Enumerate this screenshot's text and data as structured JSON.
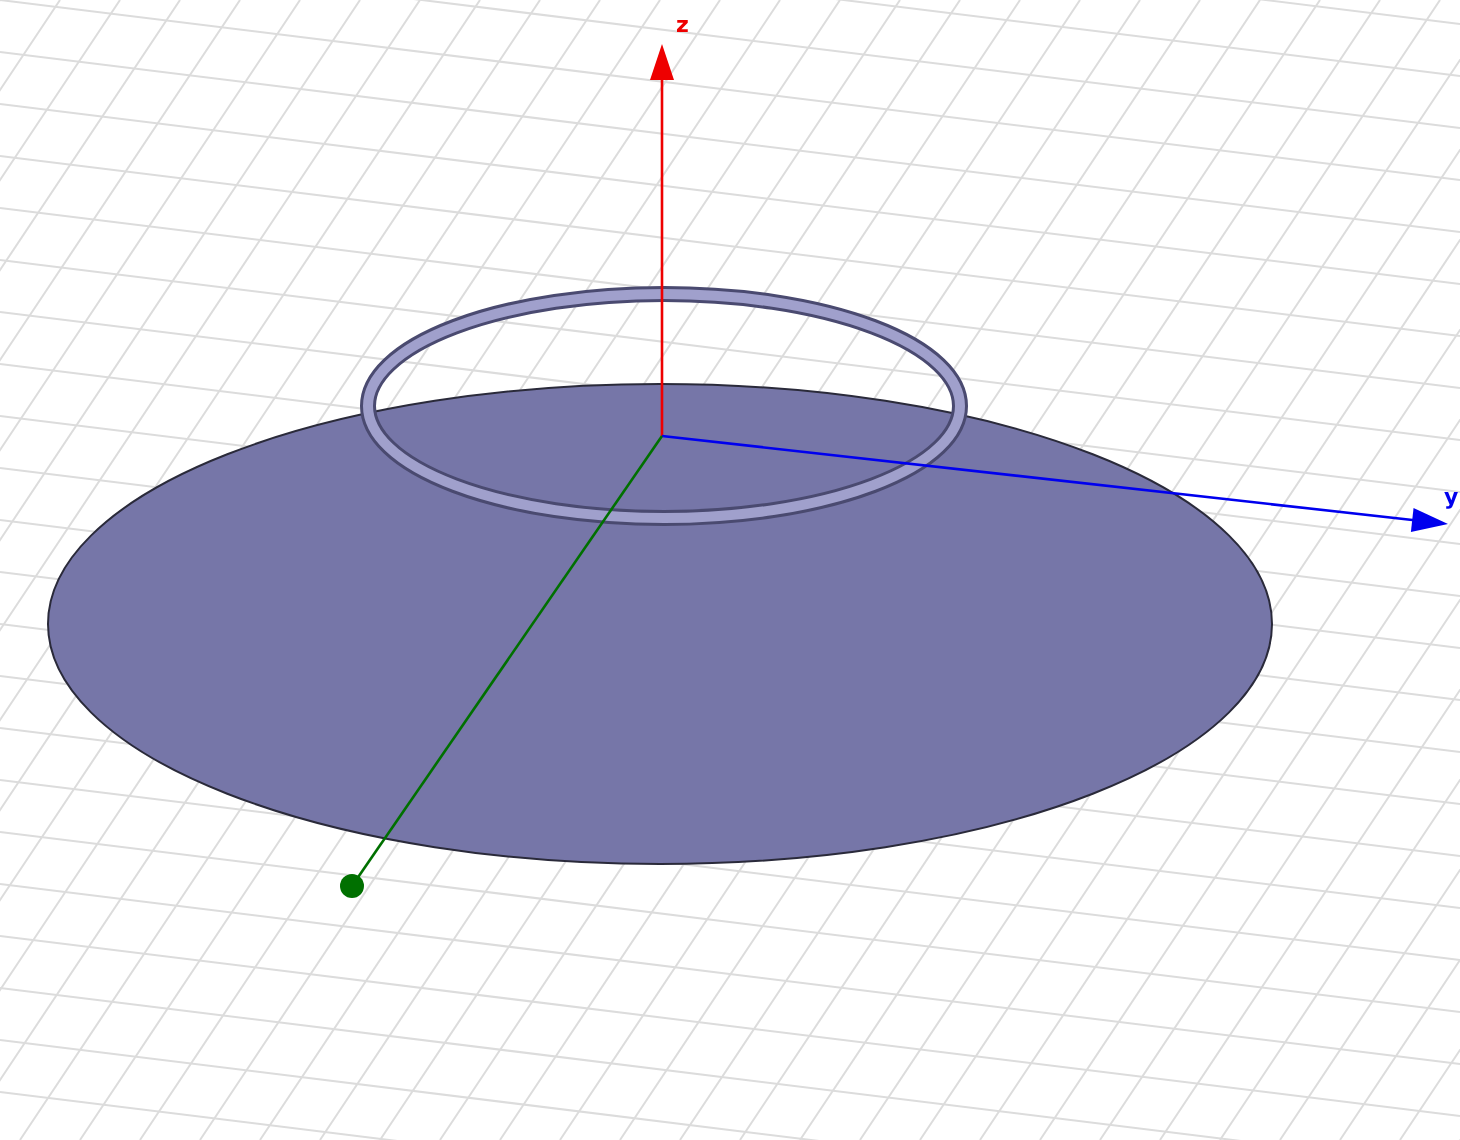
{
  "viewport": {
    "axes": [
      {
        "kind": "z",
        "label": "z",
        "color": "#ee0000"
      },
      {
        "kind": "y",
        "label": "y",
        "color": "#0000ee"
      },
      {
        "kind": "x",
        "color": "#007000"
      }
    ]
  }
}
